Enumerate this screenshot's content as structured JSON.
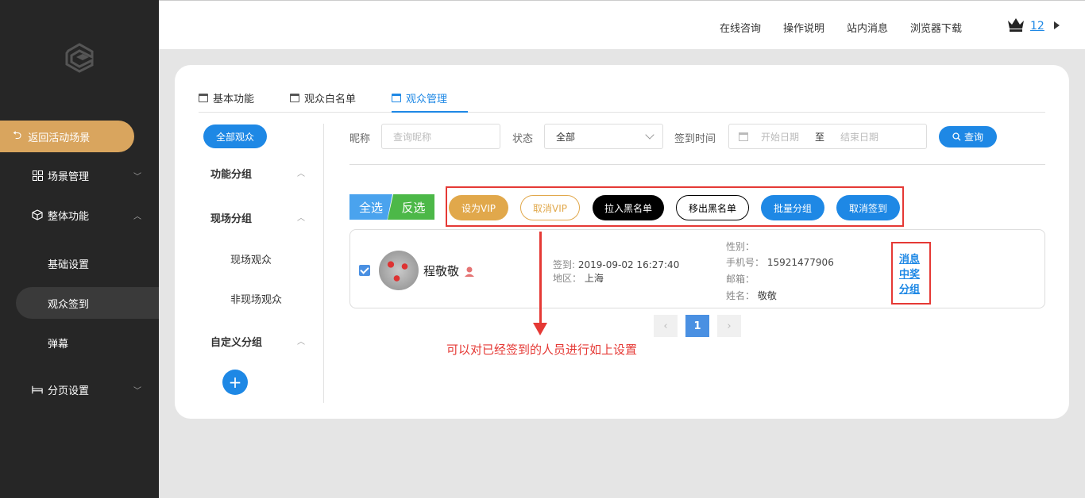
{
  "sidebar": {
    "back_label": "返回活动场景",
    "nav": [
      {
        "label": "场景管理",
        "icon": "grid-icon"
      },
      {
        "label": "整体功能",
        "icon": "cube-icon"
      }
    ],
    "sub_items": [
      {
        "label": "基础设置"
      },
      {
        "label": "观众签到"
      },
      {
        "label": "弹幕"
      }
    ],
    "page_settings": {
      "label": "分页设置",
      "icon": "bed-icon"
    }
  },
  "topbar": {
    "links": [
      "在线咨询",
      "操作说明",
      "站内消息",
      "浏览器下载"
    ],
    "vip_count": "12"
  },
  "tabs": [
    {
      "label": "基本功能"
    },
    {
      "label": "观众白名单"
    },
    {
      "label": "观众管理"
    }
  ],
  "groups": {
    "all_label": "全部观众",
    "function_group": "功能分组",
    "onsite_group": "现场分组",
    "onsite_items": [
      "现场观众",
      "非现场观众"
    ],
    "custom_group": "自定义分组",
    "add_symbol": "+"
  },
  "filters": {
    "nickname_label": "昵称",
    "nickname_placeholder": "查询昵称",
    "status_label": "状态",
    "status_value": "全部",
    "checkin_label": "签到时间",
    "start_placeholder": "开始日期",
    "to_label": "至",
    "end_placeholder": "结束日期",
    "query_label": "查询"
  },
  "actions": {
    "select_all": "全选",
    "invert": "反选",
    "buttons": [
      "设为VIP",
      "取消VIP",
      "拉入黑名单",
      "移出黑名单",
      "批量分组",
      "取消签到"
    ]
  },
  "audience": {
    "name": "程敬敬",
    "checkin_key": "签到:",
    "checkin_time": "2019-09-02 16:27:40",
    "region_key": "地区：",
    "region": "上海",
    "gender_key": "性别：",
    "gender": "",
    "phone_key": "手机号：",
    "phone": "15921477906",
    "email_key": "邮箱：",
    "email": "",
    "realname_key": "姓名：",
    "realname": "敬敬",
    "ops": [
      "消息",
      "中奖",
      "分组"
    ]
  },
  "pagination": {
    "current": "1",
    "prev": "‹",
    "next": "›"
  },
  "annotation": {
    "note": "可以对已经签到的人员进行如上设置"
  },
  "colors": {
    "sidebar_bg": "#262626",
    "accent_gold": "#d9a55e",
    "primary_blue": "#1e88e5",
    "annotation_red": "#e53935"
  }
}
